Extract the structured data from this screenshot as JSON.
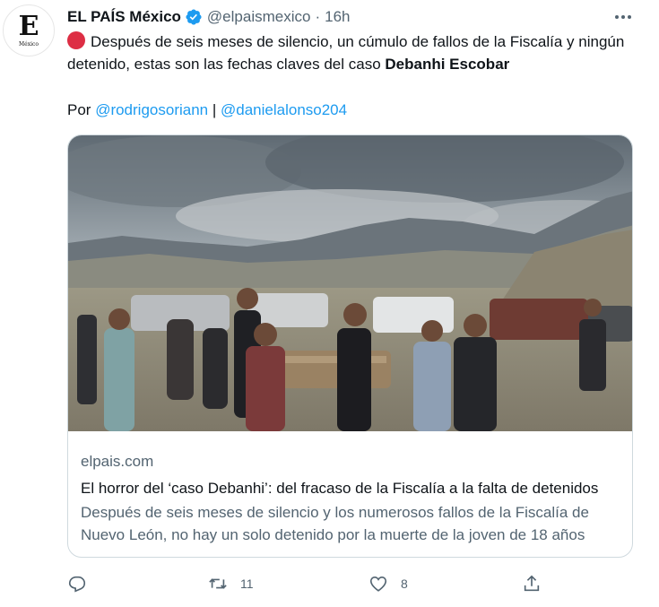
{
  "tweet": {
    "author_name": "EL PAÍS México",
    "handle": "@elpaismexico",
    "separator": "·",
    "time": "16h",
    "avatar_logo": "E",
    "avatar_sub": "México",
    "text_part1": "Después de seis meses de silencio, un cúmulo de fallos de la Fiscalía y ningún detenido, estas son las fechas claves del caso ",
    "text_bold": "Debanhi Escobar",
    "byline_prefix": "Por ",
    "mention1": "@rodrigosoriann",
    "byline_separator": " | ",
    "mention2": "@danielalonso204"
  },
  "card": {
    "domain": "elpais.com",
    "title": "El horror del ‘caso Debanhi’: del fracaso de la Fiscalía a la falta de detenidos",
    "description": "Después de seis meses de silencio y los numerosos fallos de la Fiscalía de Nuevo León, no hay un solo detenido por la muerte de la joven de 18 años"
  },
  "actions": {
    "reply_count": "",
    "retweet_count": "11",
    "like_count": "8",
    "share_count": ""
  },
  "icons": {
    "verified": "verified-badge-icon",
    "more": "more-options-icon",
    "reply": "reply-icon",
    "retweet": "retweet-icon",
    "like": "heart-icon",
    "share": "share-icon"
  },
  "colors": {
    "accent": "#1d9bf0",
    "secondary_text": "#536471",
    "primary_text": "#0f1419",
    "red_circle": "#dd2e44",
    "border": "#cfd9de"
  }
}
